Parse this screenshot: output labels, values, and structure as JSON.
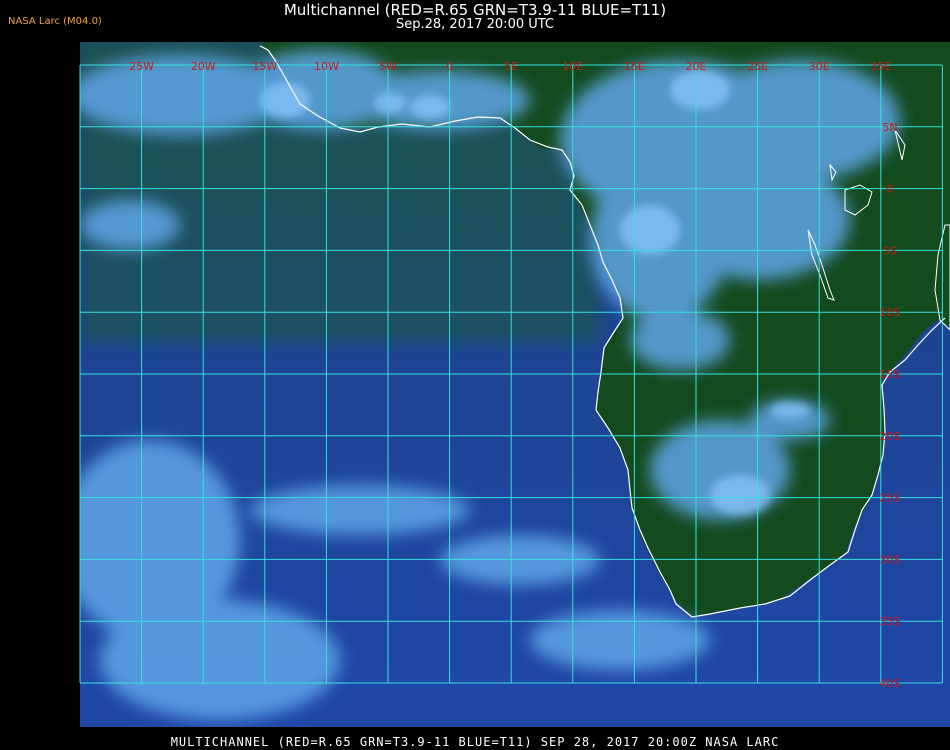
{
  "header": {
    "credit": "NASA Larc (M04.0)",
    "title": "Multichannel (RED=R.65 GRN=T3.9-11 BLUE=T11)",
    "subtitle": "Sep.28, 2017 20:00 UTC"
  },
  "footer": {
    "caption": "MULTICHANNEL (RED=R.65 GRN=T3.9-11 BLUE=T11) SEP 28, 2017 20:00Z  NASA LARC"
  },
  "map": {
    "longitude_labels": [
      "25W",
      "20W",
      "15W",
      "10W",
      "5W",
      "0",
      "5E",
      "10E",
      "15E",
      "20E",
      "25E",
      "30E",
      "35E"
    ],
    "latitude_labels": [
      "5N",
      "0",
      "5S",
      "10S",
      "15S",
      "20S",
      "25S",
      "30S",
      "35S",
      "40S"
    ],
    "colors": {
      "ocean": "#1c3f8a",
      "land": "#123d20",
      "cloud": "#5fa6e8",
      "grid": "#35e0e0",
      "coast": "#ffffff",
      "label": "#d01818"
    }
  }
}
